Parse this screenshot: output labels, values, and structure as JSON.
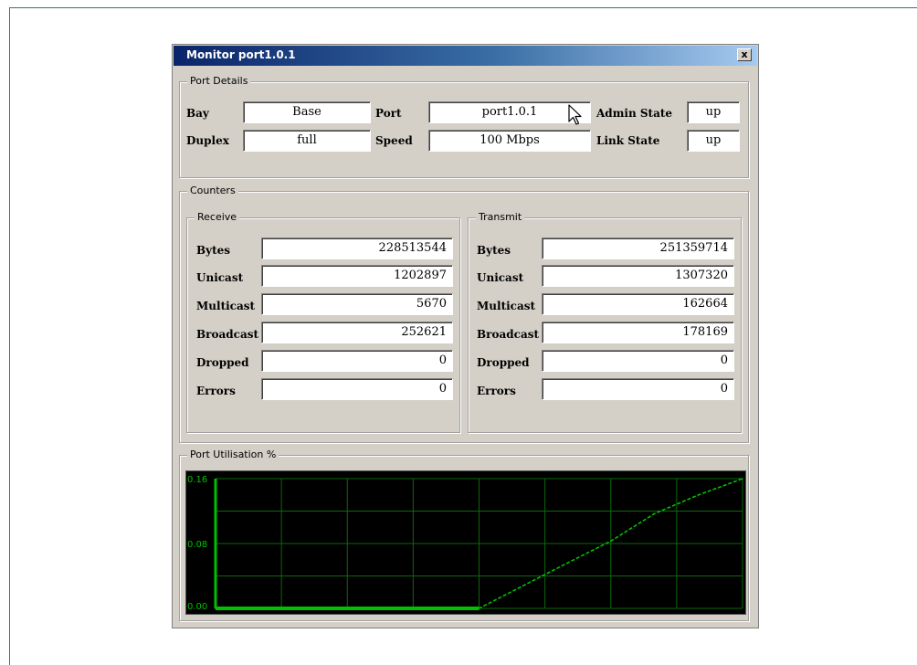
{
  "window": {
    "title": "Monitor port1.0.1",
    "close_label": "x"
  },
  "port_details": {
    "group_label": "Port Details",
    "bay_label": "Bay",
    "bay_value": "Base",
    "port_label": "Port",
    "port_value": "port1.0.1",
    "admin_state_label": "Admin State",
    "admin_state_value": "up",
    "duplex_label": "Duplex",
    "duplex_value": "full",
    "speed_label": "Speed",
    "speed_value": "100 Mbps",
    "link_state_label": "Link State",
    "link_state_value": "up"
  },
  "counters": {
    "group_label": "Counters",
    "receive": {
      "label": "Receive",
      "rows": [
        {
          "label": "Bytes",
          "value": "228513544"
        },
        {
          "label": "Unicast",
          "value": "1202897"
        },
        {
          "label": "Multicast",
          "value": "5670"
        },
        {
          "label": "Broadcast",
          "value": "252621"
        },
        {
          "label": "Dropped",
          "value": "0"
        },
        {
          "label": "Errors",
          "value": "0"
        }
      ]
    },
    "transmit": {
      "label": "Transmit",
      "rows": [
        {
          "label": "Bytes",
          "value": "251359714"
        },
        {
          "label": "Unicast",
          "value": "1307320"
        },
        {
          "label": "Multicast",
          "value": "162664"
        },
        {
          "label": "Broadcast",
          "value": "178169"
        },
        {
          "label": "Dropped",
          "value": "0"
        },
        {
          "label": "Errors",
          "value": "0"
        }
      ]
    }
  },
  "utilisation": {
    "group_label": "Port Utilisation %"
  },
  "chart_data": {
    "type": "line",
    "title": "",
    "xlabel": "",
    "ylabel": "",
    "ylim": [
      0,
      0.16
    ],
    "yticks": [
      "0.16",
      "0.08",
      "0.00"
    ],
    "grid": true,
    "x": [
      0,
      1,
      2,
      3,
      4,
      5,
      6,
      7,
      8,
      9,
      10,
      11,
      12
    ],
    "series": [
      {
        "values": [
          0,
          0,
          0,
          0,
          0,
          0,
          0,
          0.0278,
          0.0556,
          0.083,
          0.117,
          0.14,
          0.166
        ]
      }
    ],
    "colors": {
      "background": "#000000",
      "grid": "#0a6a0a",
      "line": "#00c000",
      "tick": "#00c000"
    }
  }
}
